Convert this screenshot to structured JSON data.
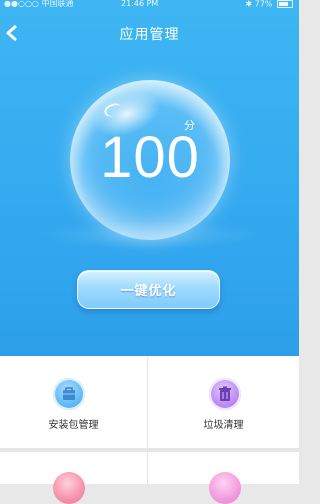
{
  "statusbar": {
    "carrier": "●●○○○ 中国联通",
    "time": "21:46 PM",
    "battery": "77%"
  },
  "navbar": {
    "title": "应用管理"
  },
  "score": {
    "value": "100",
    "unit": "分"
  },
  "optimize_button": {
    "label": "一键优化"
  },
  "tools": [
    {
      "label": "安装包管理",
      "icon": "package-icon",
      "color": "#5fb8f5"
    },
    {
      "label": "垃圾清理",
      "icon": "trash-icon",
      "color": "#b98af0"
    },
    {
      "label": "",
      "icon": "broom-icon",
      "color": "#f791ab"
    },
    {
      "label": "",
      "icon": "app-icon",
      "color": "#f29ade"
    }
  ]
}
